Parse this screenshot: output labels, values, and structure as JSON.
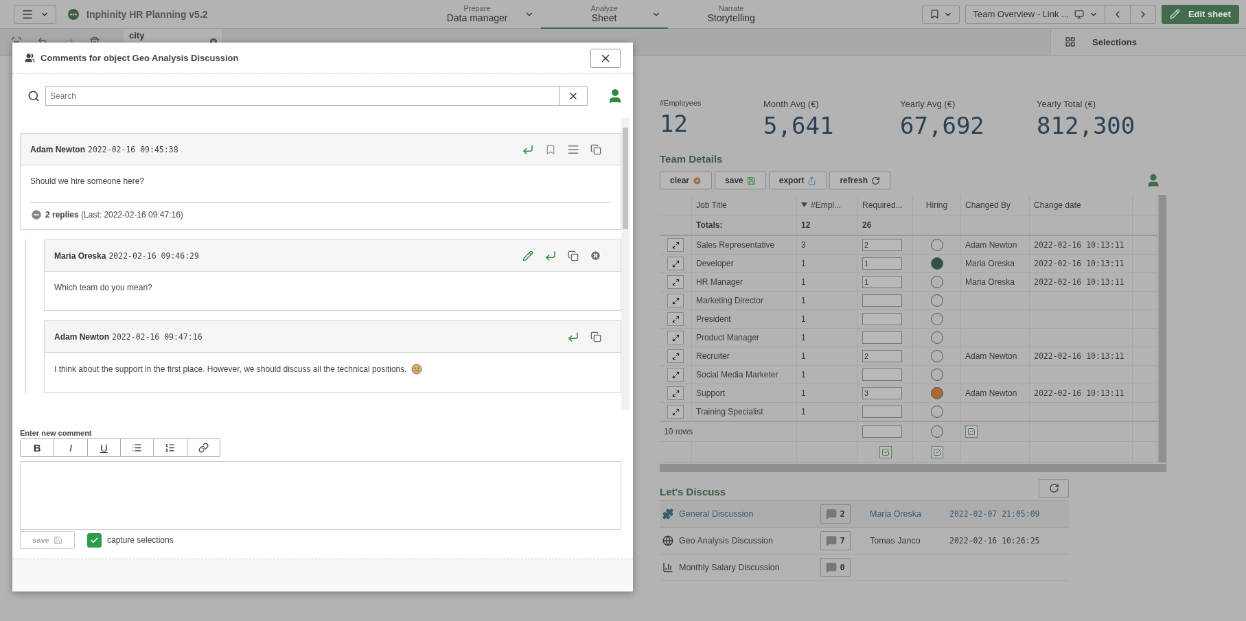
{
  "topbar": {
    "app_title": "Inphinity HR Planning v5.2",
    "nav": [
      {
        "group": "Prepare",
        "label": "Data manager",
        "selected": false,
        "has_menu": true
      },
      {
        "group": "Analyze",
        "label": "Sheet",
        "selected": true,
        "has_menu": true
      },
      {
        "group": "Narrate",
        "label": "Storytelling",
        "selected": false,
        "has_menu": false
      }
    ],
    "sheet_title": "Team Overview - Link ...",
    "edit_button": "Edit sheet"
  },
  "selection_bar": {
    "chips": [
      {
        "field": "city"
      }
    ],
    "selections_label": "Selections"
  },
  "kpis": [
    {
      "label": "#Employees",
      "value": "12"
    },
    {
      "label": "Month Avg (€)",
      "value": "5,641"
    },
    {
      "label": "Yearly Avg (€)",
      "value": "67,692"
    },
    {
      "label": "Yearly Total (€)",
      "value": "812,300"
    }
  ],
  "team_details": {
    "title": "Team Details",
    "buttons": [
      {
        "label": "clear",
        "kind": "clear"
      },
      {
        "label": "save",
        "kind": "save"
      },
      {
        "label": "export",
        "kind": "export"
      },
      {
        "label": "refresh",
        "kind": "refresh"
      }
    ],
    "columns": [
      {
        "label": "Job Title",
        "sorted": false
      },
      {
        "label": "#Empl...",
        "sorted": true
      },
      {
        "label": "Required...",
        "sorted": false
      },
      {
        "label": "Hiring",
        "sorted": false
      },
      {
        "label": "Changed By",
        "sorted": false
      },
      {
        "label": "Change date",
        "sorted": false
      }
    ],
    "totals": {
      "label": "Totals:",
      "employees": "12",
      "required": "26"
    },
    "rows": [
      {
        "job": "Sales Representative",
        "employees": "3",
        "required": "2",
        "changed_by": "Adam Newton",
        "change_date": "2022-02-16 10:13:11"
      },
      {
        "job": "Developer",
        "employees": "1",
        "required": "1",
        "hiring": {
          "color": "#2f5244"
        },
        "changed_by": "Maria Oreska",
        "change_date": "2022-02-16 10:13:11"
      },
      {
        "job": "HR Manager",
        "employees": "1",
        "required": "1",
        "changed_by": "Maria Oreska",
        "change_date": "2022-02-16 10:13:11"
      },
      {
        "job": "Marketing Director",
        "employees": "1"
      },
      {
        "job": "President",
        "employees": "1"
      },
      {
        "job": "Product Manager",
        "employees": "1"
      },
      {
        "job": "Recruiter",
        "employees": "1",
        "required": "2",
        "changed_by": "Adam Newton",
        "change_date": "2022-02-16 10:13:11"
      },
      {
        "job": "Social Media Marketer",
        "employees": "1"
      },
      {
        "job": "Support",
        "employees": "1",
        "required": "3",
        "hiring": {
          "color": "#a8683c"
        },
        "changed_by": "Adam Newton",
        "change_date": "2022-02-16 10:13:11"
      },
      {
        "job": "Training Specialist",
        "employees": "1"
      }
    ],
    "row_count": "10 rows"
  },
  "discuss": {
    "title": "Let's Discuss",
    "items": [
      {
        "kind": "puzzle",
        "title": "General Discussion",
        "count": "2",
        "author": "Maria Oreska",
        "date": "2022-02-07 21:05:09",
        "selected": true
      },
      {
        "kind": "globe",
        "title": "Geo Analysis Discussion",
        "count": "7",
        "author": "Tomas Janco",
        "date": "2022-02-16 10:26:25",
        "selected": false
      },
      {
        "kind": "chart",
        "title": "Monthly Salary Discussion",
        "count": "0",
        "selected": false
      }
    ]
  },
  "dialog": {
    "title": "Comments for object Geo Analysis Discussion",
    "search": {
      "placeholder": "Search"
    },
    "comments": [
      {
        "author": "Adam Newton",
        "time": "2022-02-16 09:45:38",
        "body": "Should we hire someone here?",
        "own": false,
        "expanded": true,
        "replies_summary": "**2 replies** (Last: 2022-02-16 09:47:16)",
        "children": [
          {
            "author": "Maria Oreska",
            "time": "2022-02-16 09:46:29",
            "body": "Which team do you mean?",
            "own": true
          },
          {
            "author": "Adam Newton",
            "time": "2022-02-16 09:47:16",
            "body": "I think about the support in the first place. However, we should discuss all the technical positions.",
            "own": false,
            "emoji": true
          }
        ]
      }
    ],
    "editor": {
      "label": "Enter new comment",
      "format_buttons": [
        "B",
        "I",
        "U"
      ],
      "save": {
        "label": "save",
        "disabled": true
      },
      "capture": {
        "label": "capture selections",
        "checked": true
      }
    }
  }
}
